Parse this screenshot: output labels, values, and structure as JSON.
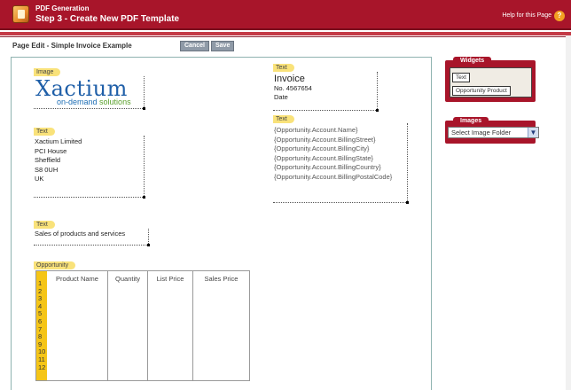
{
  "header": {
    "app_title": "PDF Generation",
    "step_title": "Step 3 - Create New PDF Template",
    "help_link": "Help for this Page",
    "help_icon": "?"
  },
  "toolbar": {
    "page_edit_label": "Page Edit - Simple Invoice Example",
    "cancel_label": "Cancel",
    "save_label": "Save"
  },
  "canvas": {
    "image_tag": "Image",
    "logo": {
      "brand": "Xactium",
      "tagline_a": "on-demand ",
      "tagline_b": "solutions"
    },
    "text_company_tag": "Text",
    "company_lines": [
      "Xactium Limited",
      "PCI House",
      "Sheffield",
      "S8 0UH",
      "UK"
    ],
    "text_sales_tag": "Text",
    "sales_text": "Sales of products and services",
    "invoice_tag": "Text",
    "invoice_title": "Invoice",
    "invoice_no": "No. 4567654",
    "invoice_date": "Date",
    "account_tag": "Text",
    "account_lines": [
      "{Opportunity.Account.Name}",
      "{Opportunity.Account.BillingStreet}",
      "{Opportunity.Account.BillingCity}",
      "{Opportunity.Account.BillingState}",
      "{Opportunity.Account.BillingCountry}",
      "{Opportunity.Account.BillingPostalCode}"
    ],
    "opportunity_tag": "Opportunity",
    "opportunity_columns": [
      "Product Name",
      "Quantity",
      "List Price",
      "Sales Price"
    ],
    "row_numbers": [
      "1",
      "2",
      "3",
      "4",
      "5",
      "6",
      "7",
      "8",
      "9",
      "10",
      "11",
      "12"
    ]
  },
  "widgets_panel": {
    "title": "Widgets",
    "items": [
      "Text",
      "Opportunity Product"
    ]
  },
  "images_panel": {
    "title": "Images",
    "select_value": "Select Image Folder"
  },
  "colors": {
    "brand_red": "#a8152a",
    "tag_yellow": "#f9e27a",
    "row_yellow": "#f5c517"
  }
}
